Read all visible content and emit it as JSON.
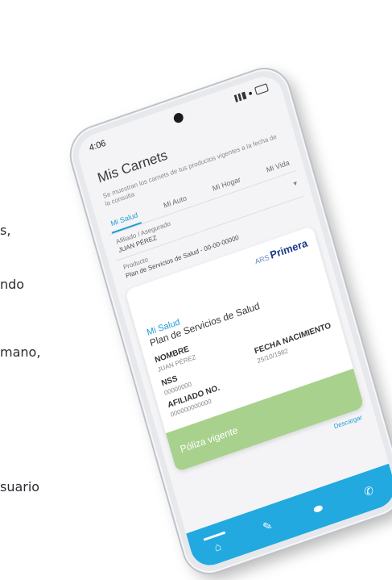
{
  "background": {
    "lines": [
      "s,",
      "ndo",
      "mano,",
      "suario"
    ]
  },
  "status_bar": {
    "time": "4:06"
  },
  "header": {
    "title": "Mis Carnets",
    "subtitle": "Se muestran los carnets de tus productos vigentes a la fecha de la consulta"
  },
  "tabs": [
    {
      "label": "Mi Salud",
      "active": true
    },
    {
      "label": "Mi Auto",
      "active": false
    },
    {
      "label": "Mi Hogar",
      "active": false
    },
    {
      "label": "Mi Vida",
      "active": false
    }
  ],
  "fields": {
    "affiliate_label": "Afiliado / Asegurado",
    "affiliate_value": "JUAN PÉREZ",
    "product_label": "Producto",
    "product_value": "Plan de Servicios de Salud - 00-00-00000"
  },
  "card": {
    "brand_prefix": "ARS",
    "brand_name": "Primera",
    "plan_tag": "Mi Salud",
    "plan_name": "Plan de Servicios de Salud",
    "name_label": "NOMBRE",
    "name_value": "JUAN PÉREZ",
    "nss_label": "NSS",
    "nss_value": "00000000",
    "birth_label": "FECHA NACIMIENTO",
    "birth_value": "25/10/1982",
    "affiliate_no_label": "AFILIADO NO.",
    "affiliate_no_value": "000000000000",
    "status": "Póliza vigente"
  },
  "download_label": "Descargar",
  "colors": {
    "accent": "#21a9e0",
    "brand_dark": "#1a3a8a",
    "valid_green": "#a8d18d"
  },
  "nav_icons": [
    "home-icon",
    "pen-icon",
    "pill-icon",
    "phone-icon"
  ]
}
